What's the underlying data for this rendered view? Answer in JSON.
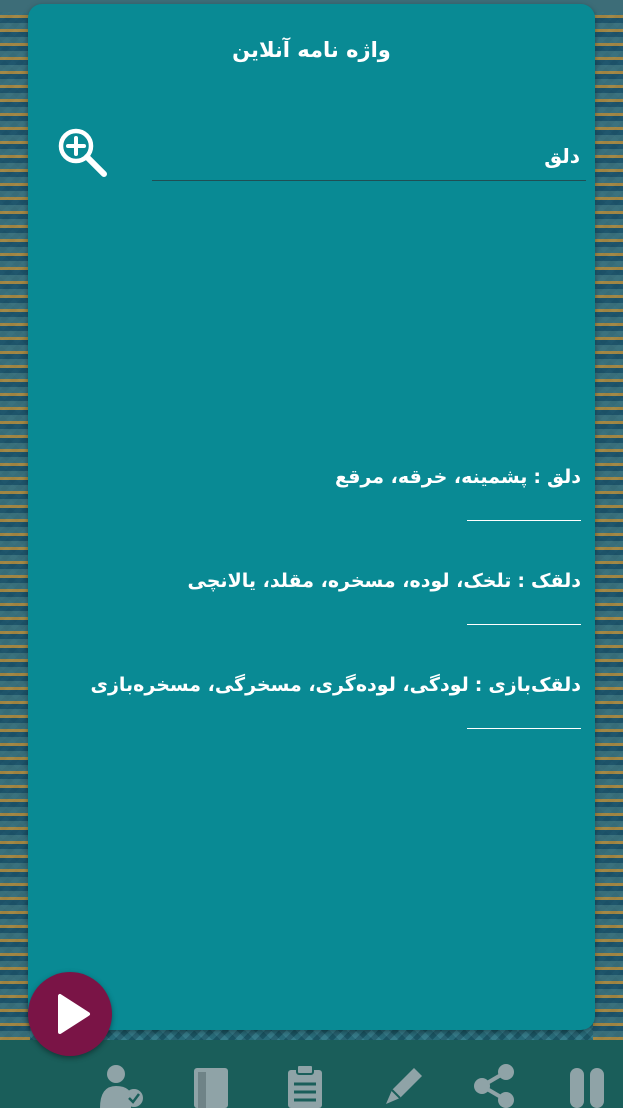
{
  "app": {
    "title": "واژه نامه آنلاین"
  },
  "search": {
    "value": "دلق",
    "icon": "zoom-in-icon"
  },
  "results": [
    {
      "term": "دلق",
      "separator": ":",
      "definition": "پشمینه، خرقه، مرقع"
    },
    {
      "term": "دلقک",
      "separator": ":",
      "definition": "تلخک، لوده، مسخره، مقلد، یالانچی"
    },
    {
      "term": "دلقک‌بازی",
      "separator": ":",
      "definition": "لودگی، لوده‌گری، مسخرگی، مسخره‌بازی"
    }
  ],
  "colors": {
    "card": "#098a94",
    "play_button": "#7a1446",
    "bottom_bar": "#1a5e5a",
    "icon": "#8fa3a7"
  },
  "bottom_nav": [
    {
      "icon": "user-check-icon"
    },
    {
      "icon": "book-icon"
    },
    {
      "icon": "clipboard-icon"
    },
    {
      "icon": "pen-icon"
    },
    {
      "icon": "share-icon"
    },
    {
      "icon": "capsule-icon"
    }
  ]
}
